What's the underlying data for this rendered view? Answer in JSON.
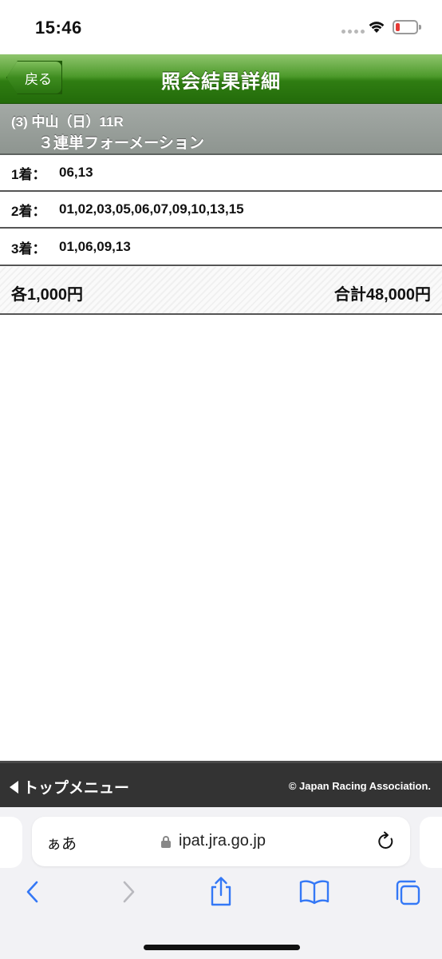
{
  "status_bar": {
    "time": "15:46"
  },
  "header": {
    "back_label": "戻る",
    "title": "照会結果詳細"
  },
  "race": {
    "line1": "(3) 中山（日）11R",
    "line2": "３連単フォーメーション"
  },
  "results": [
    {
      "label": "1着：",
      "value": "06,13"
    },
    {
      "label": "2着：",
      "value": "01,02,03,05,06,07,09,10,13,15"
    },
    {
      "label": "3着：",
      "value": "01,06,09,13"
    }
  ],
  "amounts": {
    "each": "各1,000円",
    "total": "合計48,000円"
  },
  "footer": {
    "top_menu": "トップメニュー",
    "copyright": "© Japan Racing Association."
  },
  "browser": {
    "aa_label": "ぁあ",
    "url": "ipat.jra.go.jp"
  },
  "colors": {
    "header_green": "#2f7d12",
    "race_band_gray": "#8e9590",
    "footer_dark": "#333333",
    "accent_blue": "#3478f6"
  },
  "icons": [
    "wifi-icon",
    "battery-icon",
    "triangle-left-icon",
    "lock-icon",
    "reload-icon",
    "back-icon",
    "forward-icon",
    "share-icon",
    "bookmarks-icon",
    "tabs-icon"
  ]
}
